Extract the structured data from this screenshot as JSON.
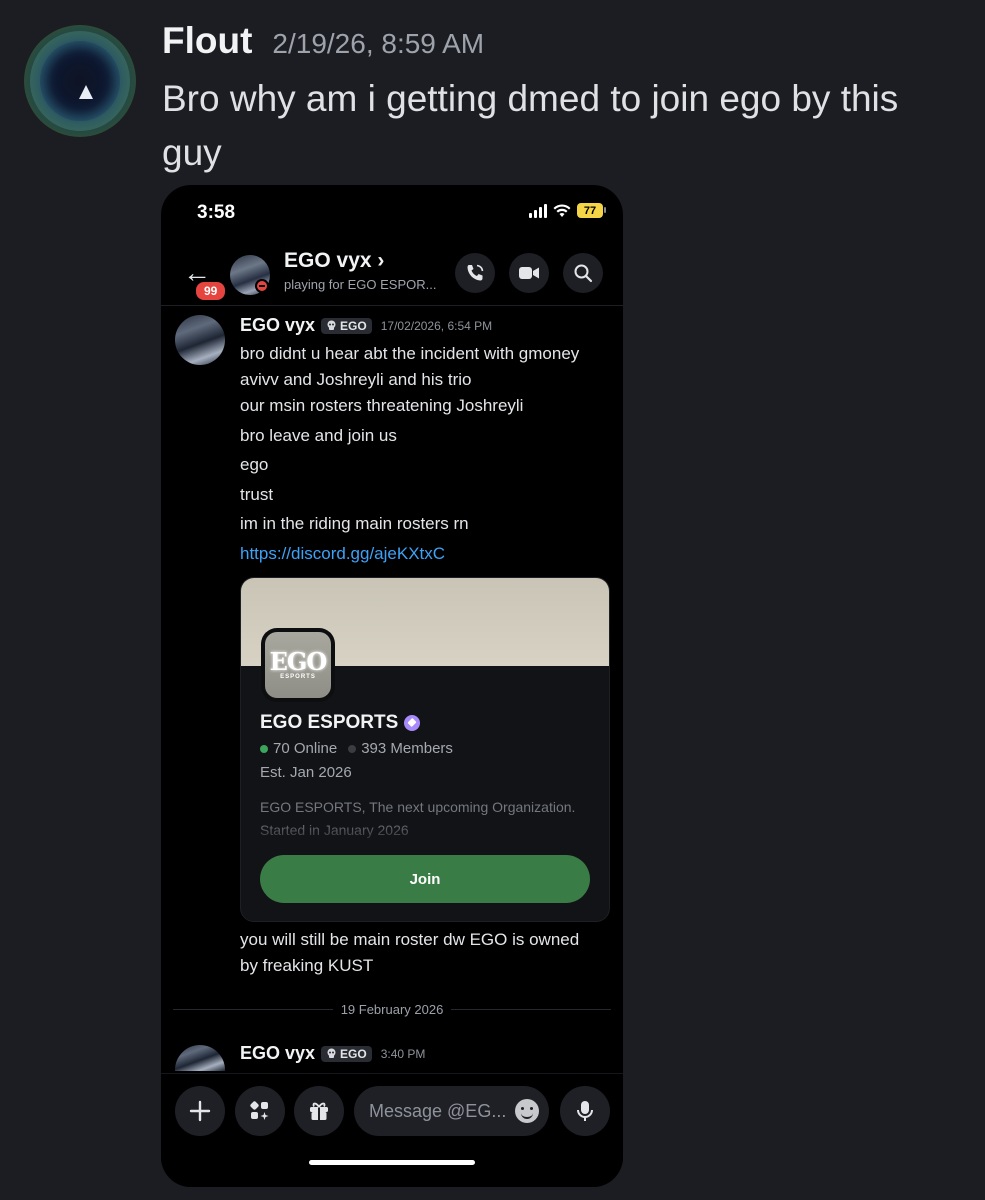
{
  "outer_message": {
    "username": "Flout",
    "timestamp": "2/19/26, 8:59 AM",
    "text": "Bro why am i getting dmed to join ego by this guy"
  },
  "phone": {
    "status": {
      "time": "3:58",
      "battery": "77"
    },
    "header": {
      "unread_badge": "99",
      "channel_name": "EGO vyx",
      "chevron": "›",
      "subtitle": "playing for EGO ESPOR..."
    },
    "message1": {
      "username": "EGO vyx",
      "tag": "EGO",
      "timestamp": "17/02/2026, 6:54 PM",
      "lines": [
        "bro didnt u hear abt the incident with gmoney avivv and Joshreyli and his trio",
        "our msin rosters threatening Joshreyli",
        "bro leave and join us",
        "ego",
        "trust",
        "im in the riding main rosters rn"
      ],
      "link": "https://discord.gg/ajeKXtxC",
      "after_text": "you will still be main roster dw EGO is owned by freaking KUST"
    },
    "invite": {
      "icon_big": "EGO",
      "icon_small": "ESPORTS",
      "guild_name": "EGO ESPORTS",
      "online": "70 Online",
      "members": "393 Members",
      "established": "Est. Jan 2026",
      "description": "EGO ESPORTS, The next upcoming Organization. Started in January 2026",
      "join_label": "Join"
    },
    "date_divider": "19 February 2026",
    "message2": {
      "username": "EGO vyx",
      "tag": "EGO",
      "timestamp": "3:40 PM"
    },
    "composer": {
      "placeholder": "Message @EG..."
    },
    "colors": {
      "join_green": "#3a7c45",
      "link_blue": "#3ea2f6",
      "badge_red": "#e5443f",
      "online_green": "#3ba55c"
    }
  }
}
